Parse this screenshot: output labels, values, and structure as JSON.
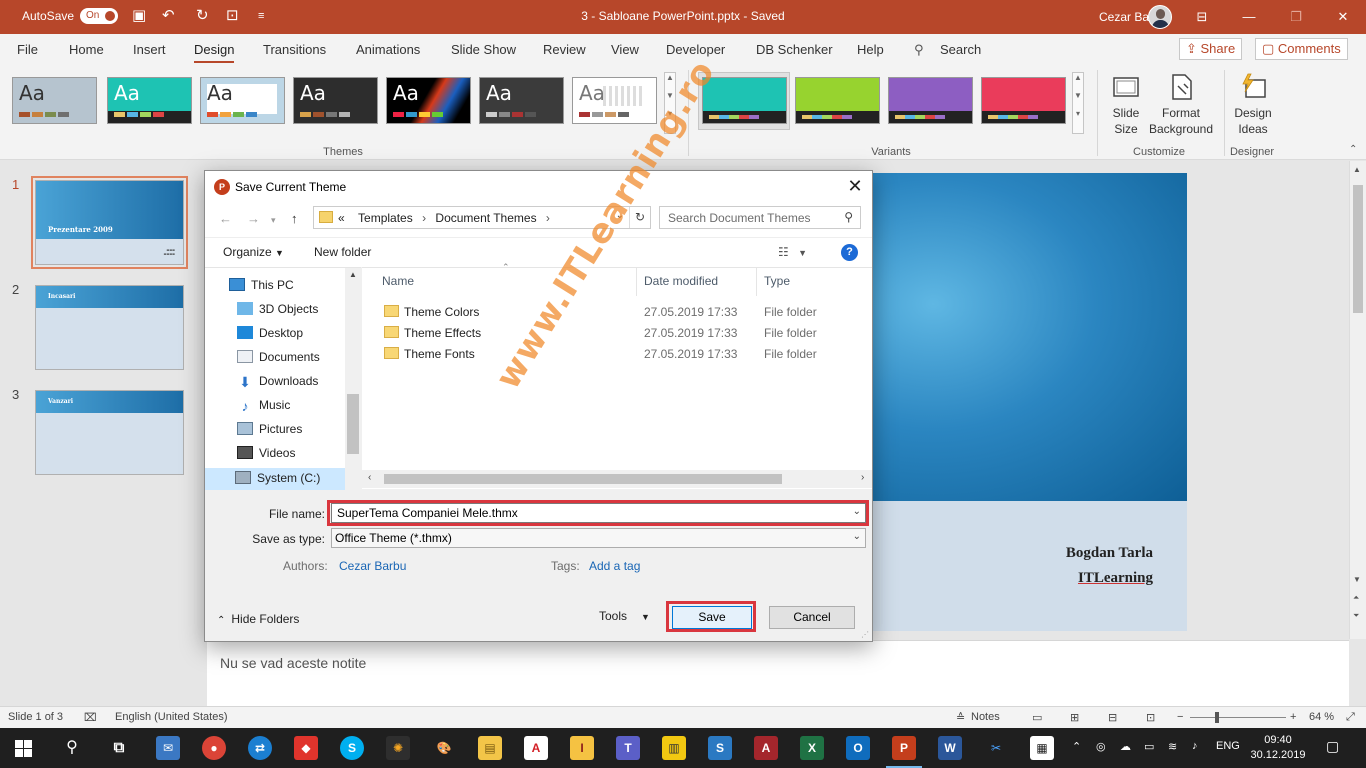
{
  "titlebar": {
    "autosave_label": "AutoSave",
    "autosave_state": "On",
    "document_title": "3 - Sabloane PowerPoint.pptx  -  Saved",
    "user_name": "Cezar Barbu"
  },
  "ribbon": {
    "tabs": [
      "File",
      "Home",
      "Insert",
      "Design",
      "Transitions",
      "Animations",
      "Slide Show",
      "Review",
      "View",
      "Developer",
      "DB Schenker",
      "Help",
      "Search"
    ],
    "active_tab": "Design",
    "share_label": "Share",
    "comments_label": "Comments",
    "theme_aa": "Aa",
    "themes_group_label": "Themes",
    "variants_group_label": "Variants",
    "customize_group_label": "Customize",
    "designer_group_label": "Designer",
    "slide_size_label": "Slide\nSize",
    "format_background_label": "Format\nBackground",
    "design_ideas_label": "Design\nIdeas",
    "colors": {
      "accent": "#b7472a"
    }
  },
  "slides_pane": {
    "numbers": [
      "1",
      "2",
      "3"
    ],
    "slide1_title": "Prezentare 2009",
    "slide2_title": "Incasari",
    "slide3_title": "Vanzari"
  },
  "main_slide": {
    "author": "Bogdan Tarla",
    "org": "ITLearning"
  },
  "notes": {
    "text": "Nu se vad aceste notite"
  },
  "dialog": {
    "title": "Save Current Theme",
    "breadcrumb_prefix": "«",
    "breadcrumb": [
      "Templates",
      "Document Themes"
    ],
    "search_placeholder": "Search Document Themes",
    "organize_label": "Organize",
    "new_folder_label": "New folder",
    "help_label": "?",
    "tree": [
      "This PC",
      "3D Objects",
      "Desktop",
      "Documents",
      "Downloads",
      "Music",
      "Pictures",
      "Videos",
      "System (C:)"
    ],
    "columns": {
      "name": "Name",
      "date": "Date modified",
      "type": "Type"
    },
    "files": [
      {
        "name": "Theme Colors",
        "date": "27.05.2019 17:33",
        "type": "File folder"
      },
      {
        "name": "Theme Effects",
        "date": "27.05.2019 17:33",
        "type": "File folder"
      },
      {
        "name": "Theme Fonts",
        "date": "27.05.2019 17:33",
        "type": "File folder"
      }
    ],
    "file_name_label": "File name:",
    "file_name_value": "SuperTema Companiei Mele.thmx",
    "save_type_label": "Save as type:",
    "save_type_value": "Office Theme (*.thmx)",
    "authors_label": "Authors:",
    "authors_value": "Cezar Barbu",
    "tags_label": "Tags:",
    "tags_value": "Add a tag",
    "hide_folders_label": "Hide Folders",
    "tools_label": "Tools",
    "save_label": "Save",
    "cancel_label": "Cancel"
  },
  "watermark": "www.ITLearning.ro",
  "statusbar": {
    "slide_info": "Slide 1 of 3",
    "language": "English (United States)",
    "notes_label": "Notes",
    "zoom": "64 %"
  },
  "taskbar": {
    "language": "ENG",
    "time": "09:40",
    "date": "30.12.2019"
  }
}
